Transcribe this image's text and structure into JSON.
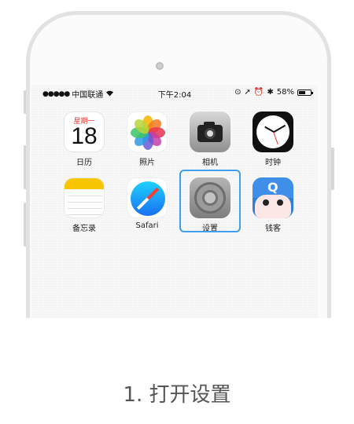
{
  "statusbar": {
    "carrier": "中国联通",
    "time": "下午2:04",
    "battery_percent": "58%",
    "battery_level": 0.58
  },
  "apps": {
    "calendar": {
      "label": "日历",
      "weekday": "星期一",
      "day": "18"
    },
    "photos": {
      "label": "照片"
    },
    "camera": {
      "label": "相机"
    },
    "clock": {
      "label": "时钟"
    },
    "notes": {
      "label": "备忘录"
    },
    "safari": {
      "label": "Safari"
    },
    "settings": {
      "label": "设置"
    },
    "qianke": {
      "label": "钱客",
      "icon_text": "Q"
    }
  },
  "highlight_color": "#3ea0ee",
  "caption": "1. 打开设置"
}
